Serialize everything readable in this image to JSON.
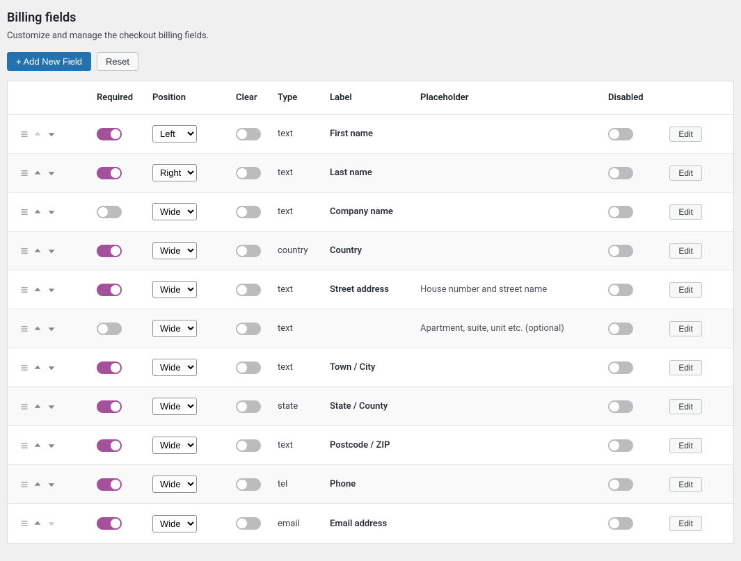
{
  "header": {
    "title": "Billing fields",
    "description": "Customize and manage the checkout billing fields.",
    "add_button": "+ Add New Field",
    "reset_button": "Reset"
  },
  "columns": {
    "required": "Required",
    "position": "Position",
    "clear": "Clear",
    "type": "Type",
    "label": "Label",
    "placeholder": "Placeholder",
    "disabled": "Disabled"
  },
  "position_options": [
    "Left",
    "Right",
    "Wide"
  ],
  "edit_label": "Edit",
  "rows": [
    {
      "required": true,
      "position": "Left",
      "clear": false,
      "type": "text",
      "label": "First name",
      "placeholder": "",
      "disabled": false,
      "up": false,
      "down": true
    },
    {
      "required": true,
      "position": "Right",
      "clear": false,
      "type": "text",
      "label": "Last name",
      "placeholder": "",
      "disabled": false,
      "up": true,
      "down": true
    },
    {
      "required": false,
      "position": "Wide",
      "clear": false,
      "type": "text",
      "label": "Company name",
      "placeholder": "",
      "disabled": false,
      "up": true,
      "down": true
    },
    {
      "required": true,
      "position": "Wide",
      "clear": false,
      "type": "country",
      "label": "Country",
      "placeholder": "",
      "disabled": false,
      "up": true,
      "down": true
    },
    {
      "required": true,
      "position": "Wide",
      "clear": false,
      "type": "text",
      "label": "Street address",
      "placeholder": "House number and street name",
      "disabled": false,
      "up": true,
      "down": true
    },
    {
      "required": false,
      "position": "Wide",
      "clear": false,
      "type": "text",
      "label": "",
      "placeholder": "Apartment, suite, unit etc. (optional)",
      "disabled": false,
      "up": true,
      "down": true
    },
    {
      "required": true,
      "position": "Wide",
      "clear": false,
      "type": "text",
      "label": "Town / City",
      "placeholder": "",
      "disabled": false,
      "up": true,
      "down": true
    },
    {
      "required": true,
      "position": "Wide",
      "clear": false,
      "type": "state",
      "label": "State / County",
      "placeholder": "",
      "disabled": false,
      "up": true,
      "down": true
    },
    {
      "required": true,
      "position": "Wide",
      "clear": false,
      "type": "text",
      "label": "Postcode / ZIP",
      "placeholder": "",
      "disabled": false,
      "up": true,
      "down": true
    },
    {
      "required": true,
      "position": "Wide",
      "clear": false,
      "type": "tel",
      "label": "Phone",
      "placeholder": "",
      "disabled": false,
      "up": true,
      "down": true
    },
    {
      "required": true,
      "position": "Wide",
      "clear": false,
      "type": "email",
      "label": "Email address",
      "placeholder": "",
      "disabled": false,
      "up": true,
      "down": false
    }
  ]
}
